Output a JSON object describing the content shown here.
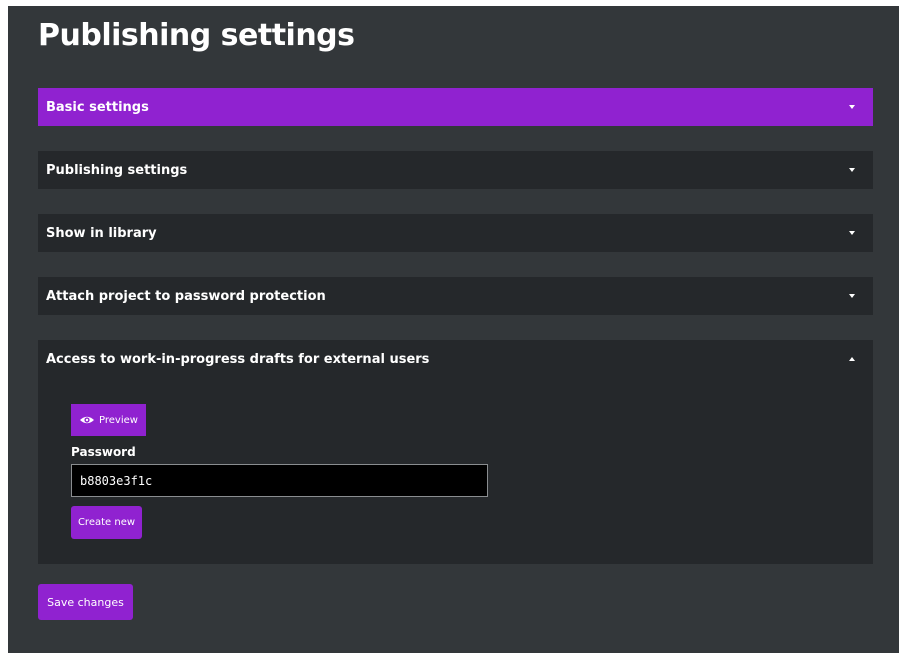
{
  "page": {
    "title": "Publishing settings"
  },
  "panels": [
    {
      "title": "Basic settings",
      "state": "collapsed",
      "highlighted": true
    },
    {
      "title": "Publishing settings",
      "state": "collapsed",
      "highlighted": false
    },
    {
      "title": "Show in library",
      "state": "collapsed",
      "highlighted": false
    },
    {
      "title": "Attach project to password protection",
      "state": "collapsed",
      "highlighted": false
    },
    {
      "title": "Access to work-in-progress drafts for external users",
      "state": "expanded",
      "highlighted": false
    }
  ],
  "drafts_access": {
    "preview_label": "Preview",
    "preview_icon": "eye-icon",
    "password_label": "Password",
    "password_value": "b8803e3f1c",
    "create_new_label": "Create new"
  },
  "footer": {
    "save_label": "Save changes"
  },
  "colors": {
    "accent": "#9022d0",
    "background": "#33373a",
    "panel": "#25282b",
    "input_background": "#000000",
    "text": "#ffffff"
  }
}
